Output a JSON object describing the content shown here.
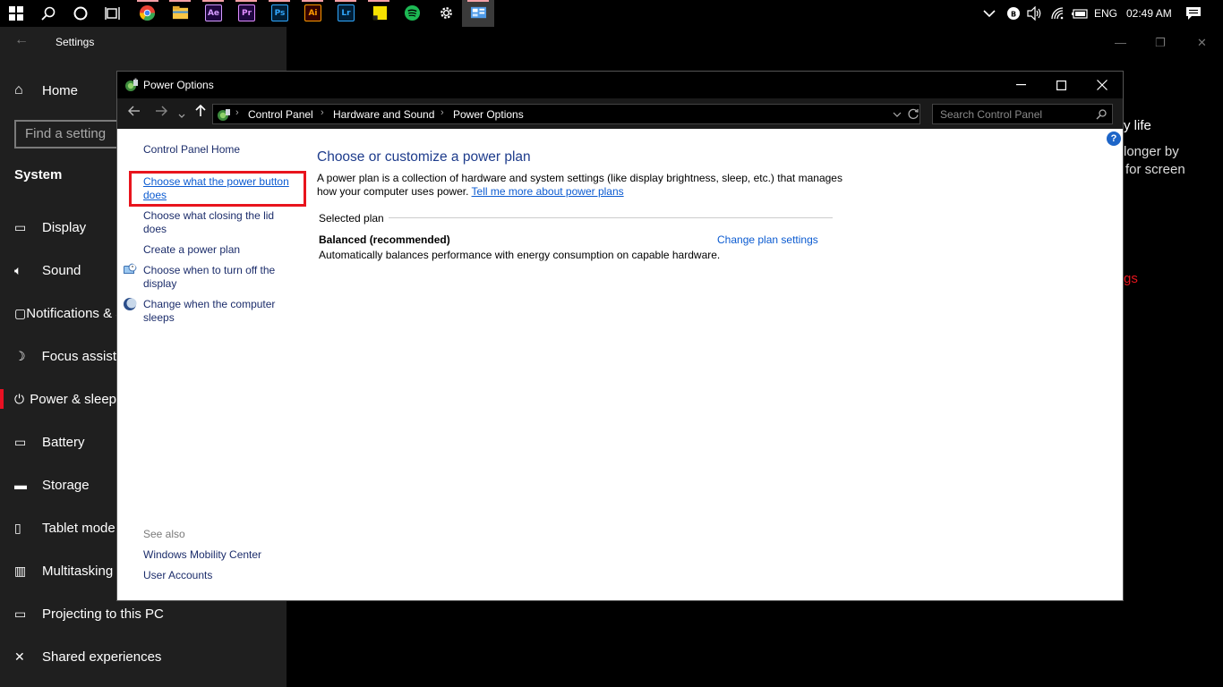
{
  "taskbar": {
    "apps": [
      {
        "name": "chrome",
        "label": "",
        "color": "#ea4335",
        "running": true
      },
      {
        "name": "file-explorer",
        "label": "",
        "color": "#f8c745",
        "running": true
      },
      {
        "name": "after-effects",
        "label": "Ae",
        "color": "#1f0740",
        "fg": "#d59cff",
        "running": true
      },
      {
        "name": "premiere-pro",
        "label": "Pr",
        "color": "#1f0740",
        "fg": "#e08cff",
        "running": true
      },
      {
        "name": "photoshop",
        "label": "Ps",
        "color": "#001e36",
        "fg": "#31a8ff",
        "running": true
      },
      {
        "name": "illustrator",
        "label": "Ai",
        "color": "#330000",
        "fg": "#ff9a00",
        "running": true
      },
      {
        "name": "lightroom",
        "label": "Lr",
        "color": "#001e36",
        "fg": "#31a8ff",
        "running": true
      },
      {
        "name": "sticky-notes",
        "label": "",
        "color": "#f5e100",
        "running": true
      },
      {
        "name": "spotify",
        "label": "",
        "color": "#1db954",
        "running": false
      },
      {
        "name": "settings",
        "label": "",
        "color": "#000000",
        "running": false
      },
      {
        "name": "control-panel",
        "label": "",
        "color": "#4f9be8",
        "running": true
      }
    ],
    "tray": {
      "language": "ENG",
      "time": "02:49 AM"
    }
  },
  "settings": {
    "title": "Settings",
    "home": "Home",
    "search_placeholder": "Find a setting",
    "section": "System",
    "nav": [
      {
        "label": "Display",
        "icon": "display-icon"
      },
      {
        "label": "Sound",
        "icon": "sound-icon"
      },
      {
        "label": "Notifications & actions",
        "icon": "notifications-icon"
      },
      {
        "label": "Focus assist",
        "icon": "focus-assist-icon"
      },
      {
        "label": "Power & sleep",
        "icon": "power-icon"
      },
      {
        "label": "Battery",
        "icon": "battery-icon"
      },
      {
        "label": "Storage",
        "icon": "storage-icon"
      },
      {
        "label": "Tablet mode",
        "icon": "tablet-icon"
      },
      {
        "label": "Multitasking",
        "icon": "multitasking-icon"
      },
      {
        "label": "Projecting to this PC",
        "icon": "projecting-icon"
      },
      {
        "label": "Shared experiences",
        "icon": "shared-icon"
      }
    ],
    "right_fragments": {
      "line1": "y life",
      "line2": "longer by",
      "line3": "for screen",
      "link": "gs"
    }
  },
  "power_window": {
    "title": "Power Options",
    "breadcrumbs": [
      "Control Panel",
      "Hardware and Sound",
      "Power Options"
    ],
    "search_placeholder": "Search Control Panel",
    "left": {
      "home": "Control Panel Home",
      "link1": "Choose what the power button does",
      "link2": "Choose what closing the lid does",
      "link3": "Create a power plan",
      "link4": "Choose when to turn off the display",
      "link5": "Change when the computer sleeps",
      "see_also": "See also",
      "see1": "Windows Mobility Center",
      "see2": "User Accounts"
    },
    "main": {
      "heading": "Choose or customize a power plan",
      "desc": "A power plan is a collection of hardware and system settings (like display brightness, sleep, etc.) that manages how your computer uses power.",
      "learn_more": "Tell me more about power plans",
      "selected_plan": "Selected plan",
      "plan_name": "Balanced (recommended)",
      "plan_desc": "Automatically balances performance with energy consumption on capable hardware.",
      "change_settings": "Change plan settings"
    }
  }
}
